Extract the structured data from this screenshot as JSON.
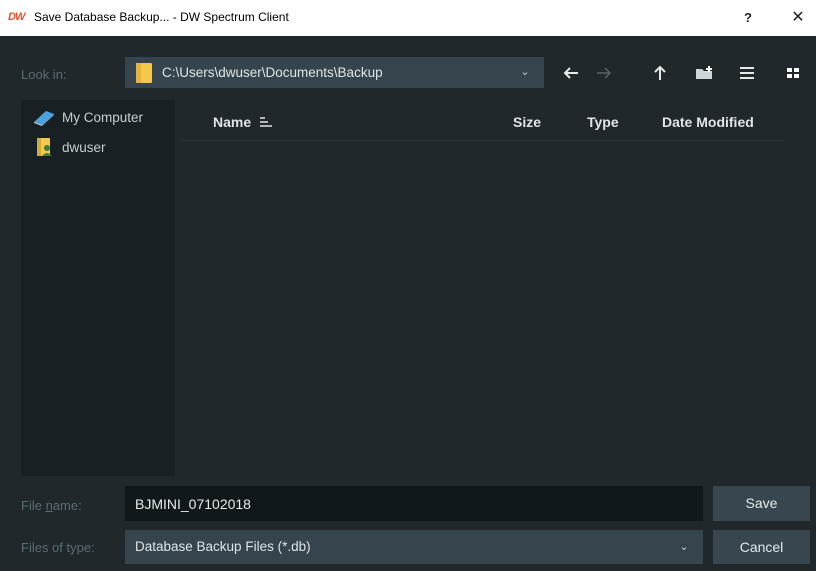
{
  "window": {
    "logo": "DW",
    "title": "Save Database Backup... - DW Spectrum Client",
    "help_label": "?",
    "close_label": "✕"
  },
  "lookin": {
    "label": "Look in:",
    "path": "C:\\Users\\dwuser\\Documents\\Backup"
  },
  "sidebar": {
    "items": [
      {
        "label": "My Computer",
        "icon": "computer-icon"
      },
      {
        "label": "dwuser",
        "icon": "user-folder-icon"
      }
    ]
  },
  "columns": {
    "name": "Name",
    "size": "Size",
    "type": "Type",
    "modified": "Date Modified"
  },
  "filename": {
    "label_prefix": "File ",
    "label_underlined": "n",
    "label_suffix": "ame:",
    "value": "BJMINI_07102018"
  },
  "filetype": {
    "label": "Files of type:",
    "value": "Database Backup Files (*.db)"
  },
  "buttons": {
    "save": "Save",
    "cancel": "Cancel"
  },
  "colors": {
    "background": "#20282c",
    "sidebar": "#182024",
    "combo": "#36454d",
    "button": "#38474f",
    "accent_logo": "#e8532b",
    "folder": "#f2c94c"
  }
}
